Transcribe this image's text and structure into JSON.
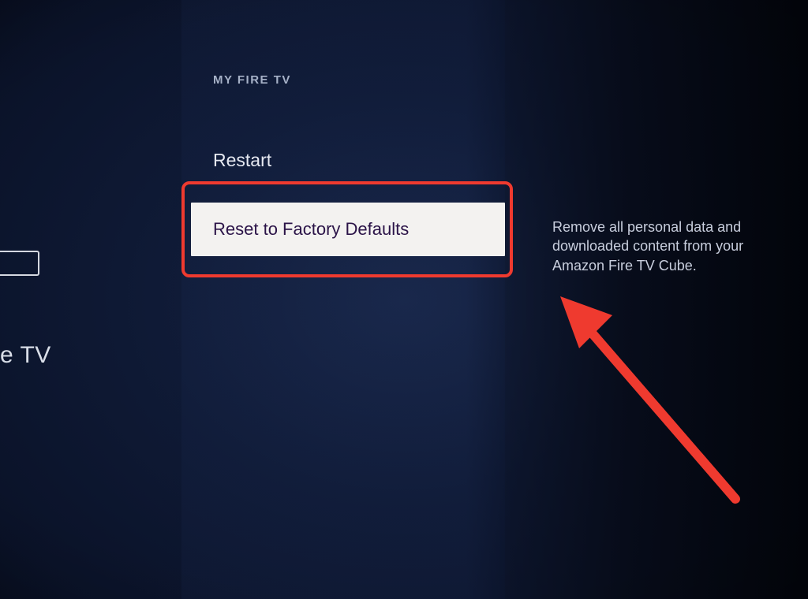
{
  "left": {
    "device_label_partial": "e TV"
  },
  "settings": {
    "section_title": "MY FIRE TV",
    "options": {
      "restart": "Restart",
      "reset": "Reset to Factory Defaults"
    }
  },
  "description": {
    "text": "Remove all personal data and downloaded content from your Amazon Fire TV Cube."
  },
  "annotation": {
    "arrow_color": "#ef3a2f",
    "highlight_color": "#ef3a2f"
  }
}
